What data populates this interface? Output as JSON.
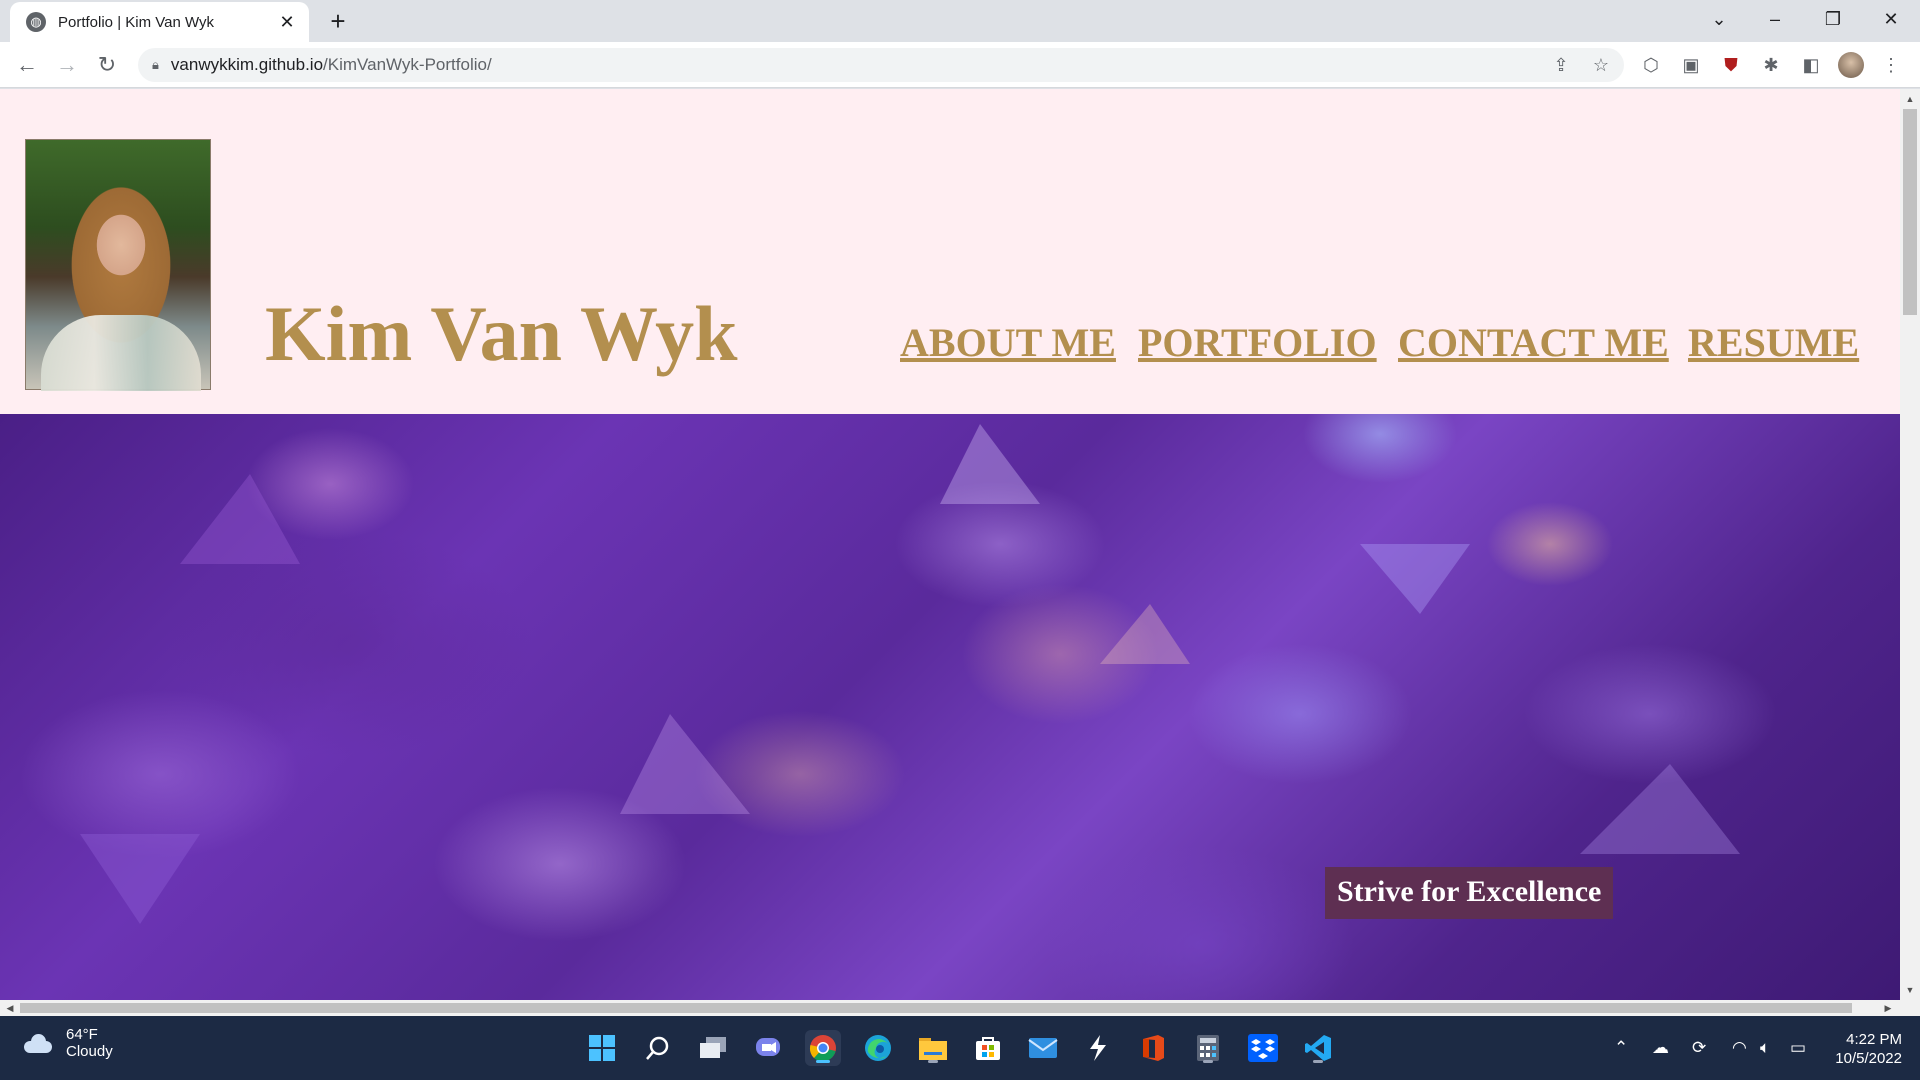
{
  "browser": {
    "tab_title": "Portfolio | Kim Van Wyk",
    "url_host": "vanwykkim.github.io",
    "url_path": "/KimVanWyk-Portfolio/"
  },
  "site": {
    "title": "Kim Van Wyk",
    "nav": [
      "ABOUT ME",
      "PORTFOLIO",
      "CONTACT ME",
      "RESUME"
    ],
    "hero_caption": "Strive for Excellence",
    "colors": {
      "header_bg": "#ffeef2",
      "gold": "#b38f4e",
      "caption_bg": "#5e2f52"
    }
  },
  "taskbar": {
    "weather_temp": "64°F",
    "weather_desc": "Cloudy",
    "time": "4:22 PM",
    "date": "10/5/2022"
  }
}
